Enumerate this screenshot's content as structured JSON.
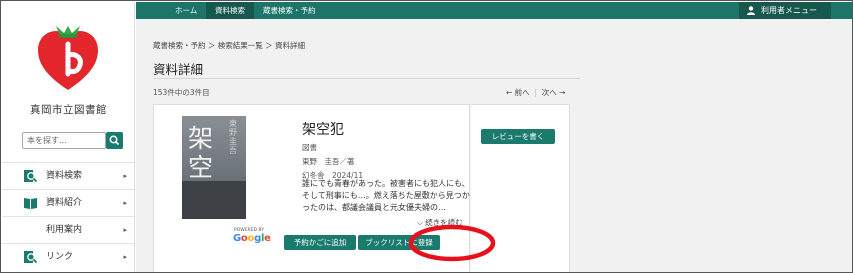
{
  "library": {
    "name": "真岡市立図書館"
  },
  "search": {
    "placeholder": "本を探す…"
  },
  "sidebar": {
    "items": [
      {
        "label": "資料検索",
        "icon": "search-doc-icon"
      },
      {
        "label": "資料紹介",
        "icon": "book-icon"
      },
      {
        "label": "利用案内",
        "icon": ""
      },
      {
        "label": "リンク",
        "icon": "link-icon"
      }
    ]
  },
  "topbar": {
    "home": "ホーム",
    "material_search": "資料検索",
    "collection_search": "蔵書検索・予約",
    "user_menu": "利用者メニュー"
  },
  "breadcrumb": "蔵書検索・予約 ＞ 検索結果一覧 ＞ 資料詳細",
  "page_title": "資料詳細",
  "result_count": "153件中の3件目",
  "pager": {
    "prev": "← 前へ",
    "next": "次へ →"
  },
  "book": {
    "title": "架空犯",
    "type": "図書",
    "author": "東野　圭吾／著",
    "publisher": "幻冬舎　2024/11",
    "description": "誰にでも青春があった。被害者にも犯人にも、そして刑事にも…。燃え落ちた屋敷から見つかったのは、都議会議員と元女優夫婦の…",
    "read_more": "続きを読む",
    "cover_title": "架空犯",
    "cover_author": "東野圭吾"
  },
  "google": {
    "powered": "POWERED BY",
    "brand": "Google"
  },
  "buttons": {
    "reserve": "予約かごに追加",
    "booklist": "ブックリストに登録",
    "review": "レビューを書く"
  },
  "colors": {
    "accent": "#1a7a6e",
    "topbar": "#1d7468",
    "highlight_ring": "#e8101a"
  }
}
